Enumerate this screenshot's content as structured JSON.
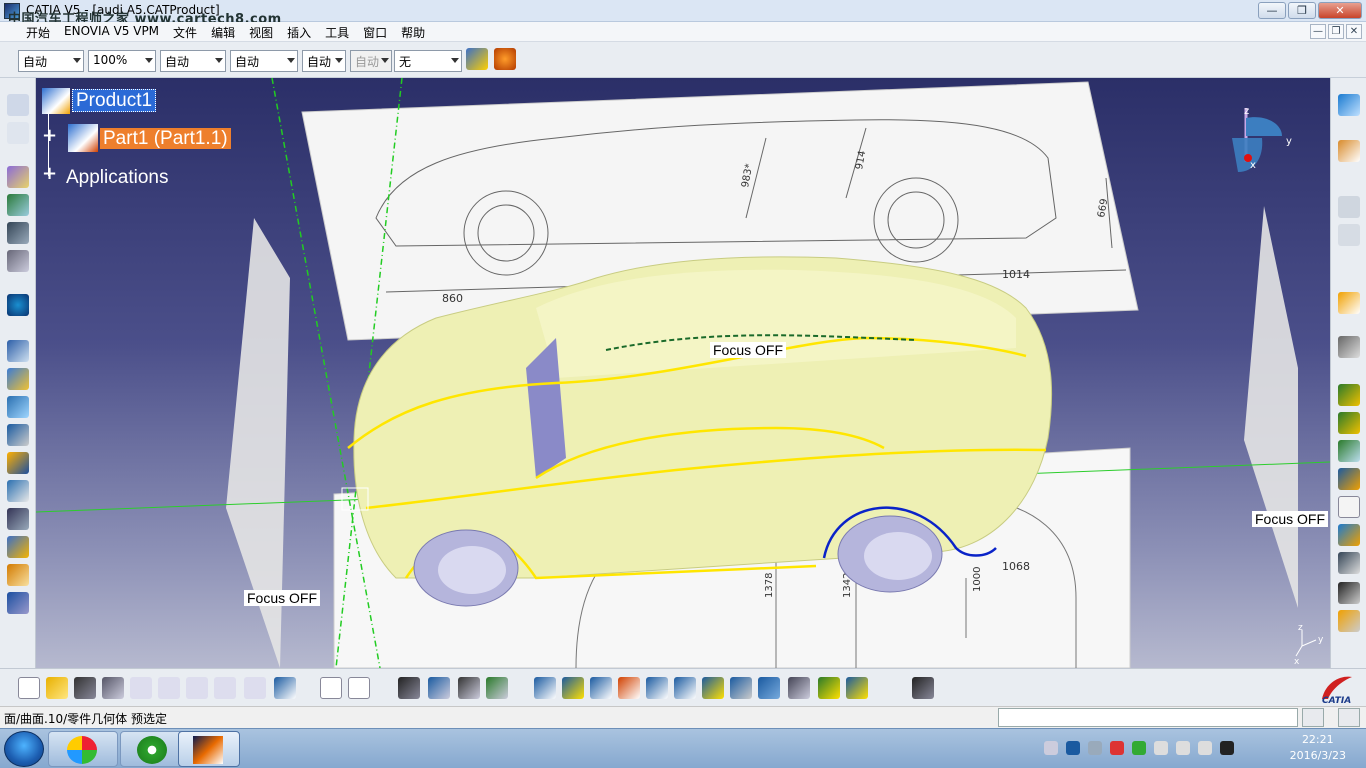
{
  "window": {
    "title": "CATIA V5 - [audi A5.CATProduct]",
    "watermark": "中国汽车工程师之家  www.cartech8.com",
    "buttons": [
      "—",
      "❐",
      "✕"
    ]
  },
  "menubar": {
    "items": [
      "开始",
      "ENOVIA V5 VPM",
      "文件",
      "编辑",
      "视图",
      "插入",
      "工具",
      "窗口",
      "帮助"
    ],
    "mdi_buttons": [
      "—",
      "❐",
      "✕"
    ]
  },
  "toolbar_top": {
    "combos": [
      {
        "value": "自动",
        "disabled": false
      },
      {
        "value": "100%",
        "disabled": false
      },
      {
        "value": "自动",
        "disabled": false
      },
      {
        "value": "自动",
        "disabled": false
      },
      {
        "value": "自动",
        "disabled": false
      },
      {
        "value": "自动",
        "disabled": true
      },
      {
        "value": "无",
        "disabled": false
      }
    ]
  },
  "tree": {
    "root": "Product1",
    "child": "Part1 (Part1.1)",
    "applications": "Applications"
  },
  "viewport": {
    "focus_labels": [
      "Focus OFF",
      "Focus OFF",
      "Focus OFF"
    ],
    "drawing_dimensions": [
      "860",
      "1014",
      "983*",
      "914",
      "669",
      "1378",
      "1342",
      "1000",
      "1068"
    ],
    "compass_axes": [
      "z",
      "y",
      "x"
    ],
    "mini_axes": [
      "z",
      "y",
      "x"
    ]
  },
  "statusbar": {
    "message": "面/曲面.10/零件几何体 预选定"
  },
  "taskbar": {
    "time": "22:21",
    "date": "2016/3/23"
  },
  "colors": {
    "viewport_top": "#2b2f68",
    "body_yellow": "#eef0b4",
    "curve_yellow": "#ffe600",
    "curve_blue": "#0a23c8",
    "axis_green": "#22cc22"
  }
}
